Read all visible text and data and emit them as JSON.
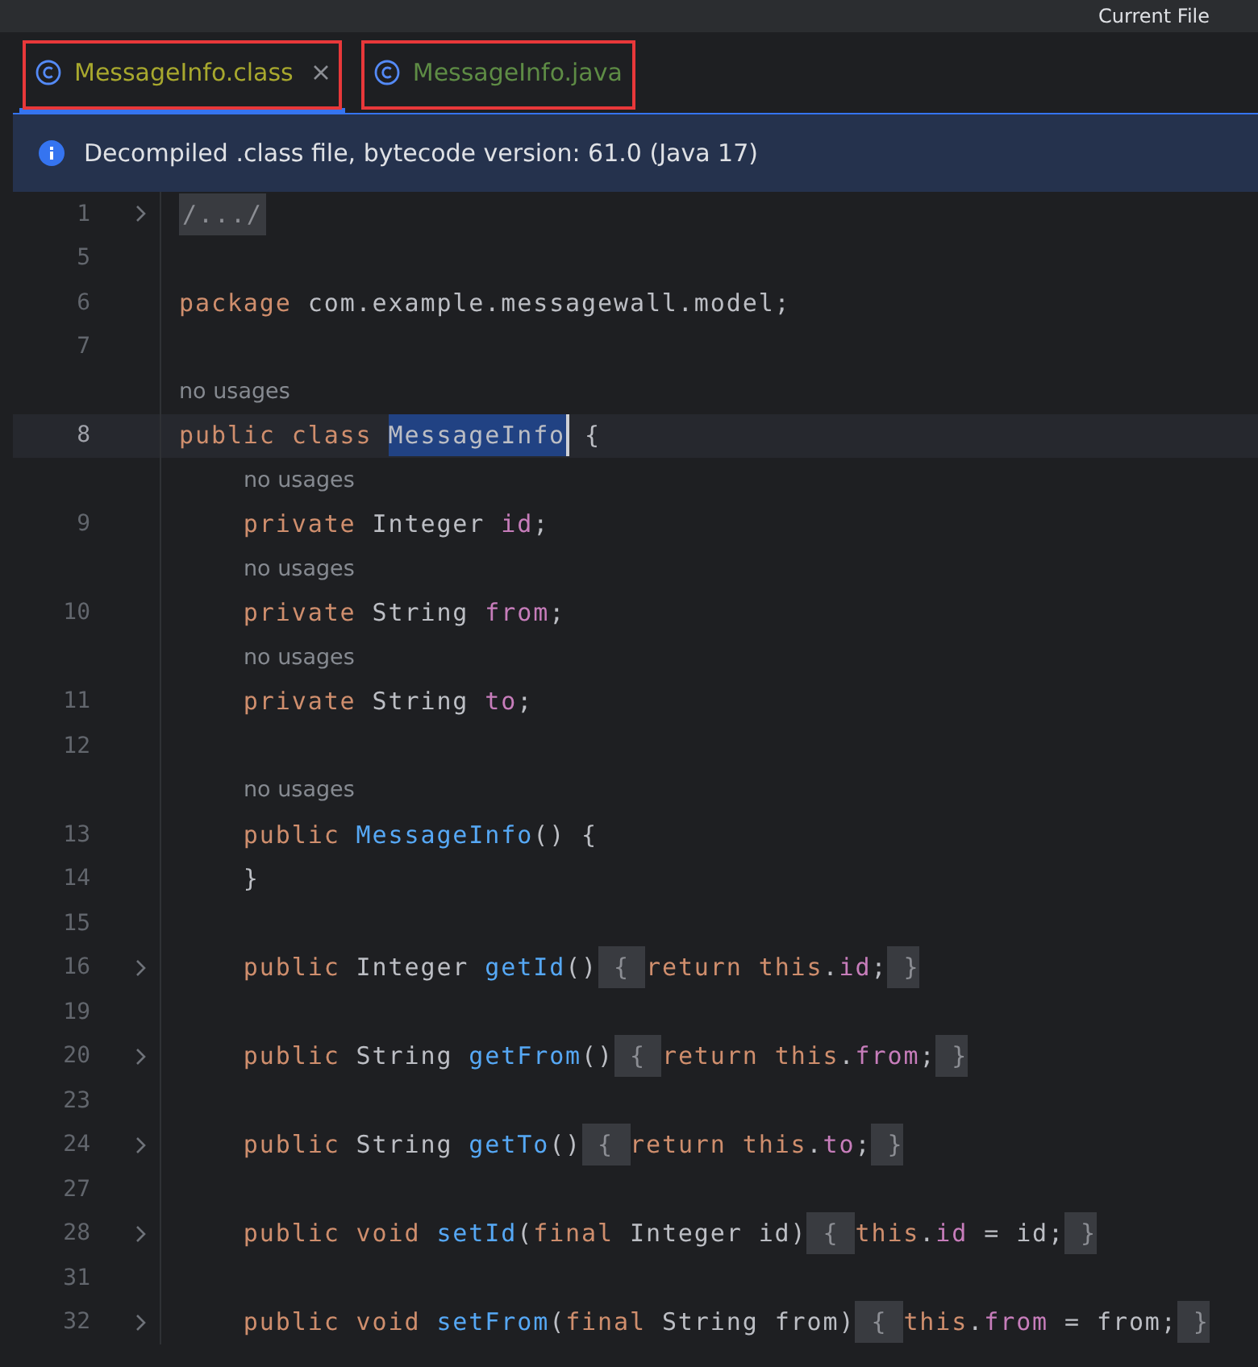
{
  "toolbar": {
    "run_config": "Current File"
  },
  "tabs": [
    {
      "label": "MessageInfo.class",
      "selected": true,
      "closable": true,
      "color": "#a8a82e",
      "annotated": true
    },
    {
      "label": "MessageInfo.java",
      "selected": false,
      "closable": false,
      "color": "#5e8c45",
      "annotated": true
    }
  ],
  "banner": {
    "text": "Decompiled .class file, bytecode version: 61.0 (Java 17)"
  },
  "rows": [
    {
      "kind": "code",
      "number": "1",
      "fold": true,
      "current": false,
      "tokens": [
        {
          "text": "/.../",
          "kind": "folded"
        }
      ]
    },
    {
      "kind": "code",
      "number": "5",
      "fold": false,
      "current": false,
      "tokens": []
    },
    {
      "kind": "code",
      "number": "6",
      "fold": false,
      "current": false,
      "tokens": [
        {
          "text": "package",
          "kind": "kw"
        },
        {
          "text": " com.example.messagewall.model;",
          "kind": "plain"
        }
      ]
    },
    {
      "kind": "code",
      "number": "7",
      "fold": false,
      "current": false,
      "tokens": []
    },
    {
      "kind": "hint",
      "text": "no usages",
      "nested": false
    },
    {
      "kind": "code",
      "number": "8",
      "fold": false,
      "current": true,
      "tokens": [
        {
          "text": "public class ",
          "kind": "kw"
        },
        {
          "text": "MessageInfo",
          "kind": "sel"
        },
        {
          "text": " {",
          "kind": "plain"
        }
      ]
    },
    {
      "kind": "hint",
      "text": "no usages",
      "nested": true
    },
    {
      "kind": "code",
      "number": "9",
      "fold": false,
      "current": false,
      "tokens": [
        {
          "text": "    private ",
          "kind": "kw"
        },
        {
          "text": "Integer ",
          "kind": "plain"
        },
        {
          "text": "id",
          "kind": "field"
        },
        {
          "text": ";",
          "kind": "plain"
        }
      ]
    },
    {
      "kind": "hint",
      "text": "no usages",
      "nested": true
    },
    {
      "kind": "code",
      "number": "10",
      "fold": false,
      "current": false,
      "tokens": [
        {
          "text": "    private ",
          "kind": "kw"
        },
        {
          "text": "String ",
          "kind": "plain"
        },
        {
          "text": "from",
          "kind": "field"
        },
        {
          "text": ";",
          "kind": "plain"
        }
      ]
    },
    {
      "kind": "hint",
      "text": "no usages",
      "nested": true
    },
    {
      "kind": "code",
      "number": "11",
      "fold": false,
      "current": false,
      "tokens": [
        {
          "text": "    private ",
          "kind": "kw"
        },
        {
          "text": "String ",
          "kind": "plain"
        },
        {
          "text": "to",
          "kind": "field"
        },
        {
          "text": ";",
          "kind": "plain"
        }
      ]
    },
    {
      "kind": "code",
      "number": "12",
      "fold": false,
      "current": false,
      "tokens": []
    },
    {
      "kind": "hint",
      "text": "no usages",
      "nested": true
    },
    {
      "kind": "code",
      "number": "13",
      "fold": false,
      "current": false,
      "tokens": [
        {
          "text": "    public ",
          "kind": "kw"
        },
        {
          "text": "MessageInfo",
          "kind": "method"
        },
        {
          "text": "() {",
          "kind": "plain"
        }
      ]
    },
    {
      "kind": "code",
      "number": "14",
      "fold": false,
      "current": false,
      "tokens": [
        {
          "text": "    }",
          "kind": "plain"
        }
      ]
    },
    {
      "kind": "code",
      "number": "15",
      "fold": false,
      "current": false,
      "tokens": []
    },
    {
      "kind": "code",
      "number": "16",
      "fold": true,
      "current": false,
      "tokens": [
        {
          "text": "    public ",
          "kind": "kw"
        },
        {
          "text": "Integer ",
          "kind": "plain"
        },
        {
          "text": "getId",
          "kind": "method"
        },
        {
          "text": "()",
          "kind": "plain"
        },
        {
          "text": " { ",
          "kind": "fold"
        },
        {
          "text": "return this",
          "kind": "kw"
        },
        {
          "text": ".",
          "kind": "plain"
        },
        {
          "text": "id",
          "kind": "field"
        },
        {
          "text": ";",
          "kind": "plain"
        },
        {
          "text": " }",
          "kind": "fold"
        }
      ]
    },
    {
      "kind": "code",
      "number": "19",
      "fold": false,
      "current": false,
      "tokens": []
    },
    {
      "kind": "code",
      "number": "20",
      "fold": true,
      "current": false,
      "tokens": [
        {
          "text": "    public ",
          "kind": "kw"
        },
        {
          "text": "String ",
          "kind": "plain"
        },
        {
          "text": "getFrom",
          "kind": "method"
        },
        {
          "text": "()",
          "kind": "plain"
        },
        {
          "text": " { ",
          "kind": "fold"
        },
        {
          "text": "return this",
          "kind": "kw"
        },
        {
          "text": ".",
          "kind": "plain"
        },
        {
          "text": "from",
          "kind": "field"
        },
        {
          "text": ";",
          "kind": "plain"
        },
        {
          "text": " }",
          "kind": "fold"
        }
      ]
    },
    {
      "kind": "code",
      "number": "23",
      "fold": false,
      "current": false,
      "tokens": []
    },
    {
      "kind": "code",
      "number": "24",
      "fold": true,
      "current": false,
      "tokens": [
        {
          "text": "    public ",
          "kind": "kw"
        },
        {
          "text": "String ",
          "kind": "plain"
        },
        {
          "text": "getTo",
          "kind": "method"
        },
        {
          "text": "()",
          "kind": "plain"
        },
        {
          "text": " { ",
          "kind": "fold"
        },
        {
          "text": "return this",
          "kind": "kw"
        },
        {
          "text": ".",
          "kind": "plain"
        },
        {
          "text": "to",
          "kind": "field"
        },
        {
          "text": ";",
          "kind": "plain"
        },
        {
          "text": " }",
          "kind": "fold"
        }
      ]
    },
    {
      "kind": "code",
      "number": "27",
      "fold": false,
      "current": false,
      "tokens": []
    },
    {
      "kind": "code",
      "number": "28",
      "fold": true,
      "current": false,
      "tokens": [
        {
          "text": "    public void ",
          "kind": "kw"
        },
        {
          "text": "setId",
          "kind": "method"
        },
        {
          "text": "(",
          "kind": "plain"
        },
        {
          "text": "final ",
          "kind": "kw"
        },
        {
          "text": "Integer id)",
          "kind": "plain"
        },
        {
          "text": " { ",
          "kind": "fold"
        },
        {
          "text": "this",
          "kind": "kw"
        },
        {
          "text": ".",
          "kind": "plain"
        },
        {
          "text": "id",
          "kind": "field"
        },
        {
          "text": " = id;",
          "kind": "plain"
        },
        {
          "text": " }",
          "kind": "fold"
        }
      ]
    },
    {
      "kind": "code",
      "number": "31",
      "fold": false,
      "current": false,
      "tokens": []
    },
    {
      "kind": "code",
      "number": "32",
      "fold": true,
      "current": false,
      "tokens": [
        {
          "text": "    public void ",
          "kind": "kw"
        },
        {
          "text": "setFrom",
          "kind": "method"
        },
        {
          "text": "(",
          "kind": "plain"
        },
        {
          "text": "final ",
          "kind": "kw"
        },
        {
          "text": "String from)",
          "kind": "plain"
        },
        {
          "text": " { ",
          "kind": "fold"
        },
        {
          "text": "this",
          "kind": "kw"
        },
        {
          "text": ".",
          "kind": "plain"
        },
        {
          "text": "from",
          "kind": "field"
        },
        {
          "text": " = from;",
          "kind": "plain"
        },
        {
          "text": " }",
          "kind": "fold"
        }
      ]
    }
  ]
}
